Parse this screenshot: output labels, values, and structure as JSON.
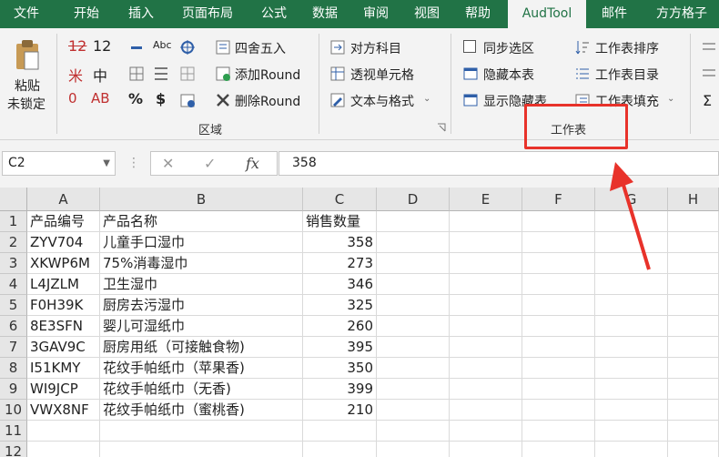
{
  "menu": {
    "tabs": [
      {
        "label": "文件"
      },
      {
        "label": "开始"
      },
      {
        "label": "插入"
      },
      {
        "label": "页面布局"
      },
      {
        "label": "公式"
      },
      {
        "label": "数据"
      },
      {
        "label": "审阅"
      },
      {
        "label": "视图"
      },
      {
        "label": "帮助"
      },
      {
        "label": "AudTool"
      },
      {
        "label": "邮件"
      },
      {
        "label": "方方格子"
      }
    ],
    "active_tab": "AudTool"
  },
  "ribbon": {
    "paste_line1": "粘贴",
    "paste_line2": "未锁定",
    "num_a": "12",
    "num_b": "12",
    "mid": "中",
    "percent": "%",
    "dollar": "$",
    "abc": "Abc",
    "round": "四舍五入",
    "add_round": "添加Round",
    "del_round": "删除Round",
    "group_region": "区域",
    "opposite_subject": "对方科目",
    "pivot_cell": "透视单元格",
    "text_format": "文本与格式",
    "sync_select": "同步选区",
    "hide_sheet": "隐藏本表",
    "show_hidden": "显示隐藏表",
    "sheet_sort": "工作表排序",
    "sheet_toc": "工作表目录",
    "sheet_fill": "工作表填充",
    "group_sheet": "工作表"
  },
  "formula_bar": {
    "name_box": "C2",
    "cancel": "✕",
    "confirm": "✓",
    "fx": "fx",
    "content": "358"
  },
  "sheet": {
    "columns": [
      "A",
      "B",
      "C",
      "D",
      "E",
      "F",
      "G",
      "H"
    ],
    "rows": [
      "1",
      "2",
      "3",
      "4",
      "5",
      "6",
      "7",
      "8",
      "9",
      "10",
      "11",
      "12"
    ],
    "data": [
      {
        "a": "产品编号",
        "b": "产品名称",
        "c": "销售数量"
      },
      {
        "a": "ZYV704",
        "b": "儿童手口湿巾",
        "c": "358"
      },
      {
        "a": "XKWP6M",
        "b": "75%消毒湿巾",
        "c": "273"
      },
      {
        "a": "L4JZLM",
        "b": "卫生湿巾",
        "c": "346"
      },
      {
        "a": "F0H39K",
        "b": "厨房去污湿巾",
        "c": "325"
      },
      {
        "a": "8E3SFN",
        "b": "婴儿可湿纸巾",
        "c": "260"
      },
      {
        "a": "3GAV9C",
        "b": "厨房用纸（可接触食物)",
        "c": "395"
      },
      {
        "a": "I51KMY",
        "b": "花纹手帕纸巾（苹果香)",
        "c": "350"
      },
      {
        "a": "WI9JCP",
        "b": "花纹手帕纸巾（无香)",
        "c": "399"
      },
      {
        "a": "VWX8NF",
        "b": "花纹手帕纸巾（蜜桃香)",
        "c": "210"
      }
    ]
  },
  "colors": {
    "excel_green": "#217346",
    "highlight_red": "#e8322a"
  }
}
